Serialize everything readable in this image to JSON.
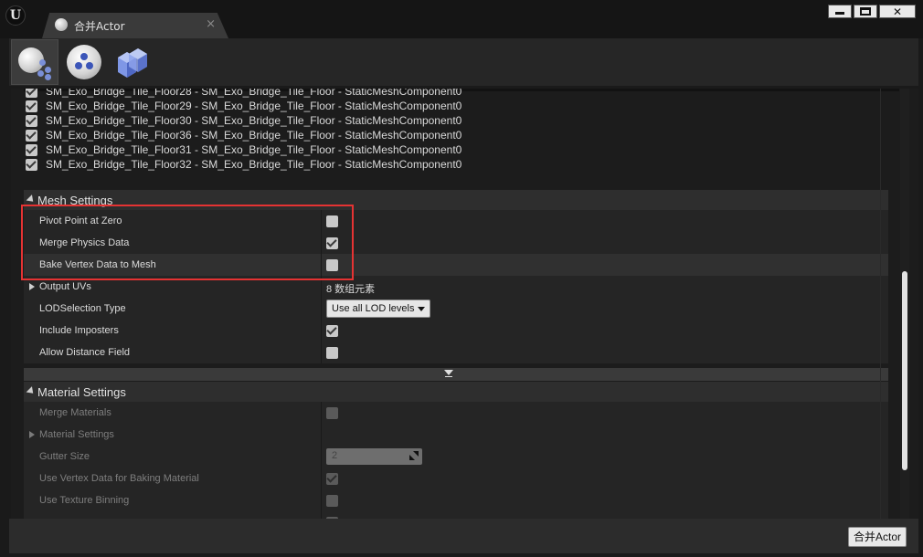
{
  "window": {
    "tab_title": "合并Actor",
    "tab_close": "×",
    "close_glyph": "✕"
  },
  "toolbar": {
    "tools": [
      {
        "icon": "actor-merge-icon",
        "active": true
      },
      {
        "icon": "harvest-instances-icon",
        "active": false
      },
      {
        "icon": "proxy-geometry-icon",
        "active": false
      }
    ]
  },
  "components": [
    "SM_Exo_Bridge_Tile_Floor28 - SM_Exo_Bridge_Tile_Floor - StaticMeshComponent0",
    "SM_Exo_Bridge_Tile_Floor29 - SM_Exo_Bridge_Tile_Floor - StaticMeshComponent0",
    "SM_Exo_Bridge_Tile_Floor30 - SM_Exo_Bridge_Tile_Floor - StaticMeshComponent0",
    "SM_Exo_Bridge_Tile_Floor36 - SM_Exo_Bridge_Tile_Floor - StaticMeshComponent0",
    "SM_Exo_Bridge_Tile_Floor31 - SM_Exo_Bridge_Tile_Floor - StaticMeshComponent0",
    "SM_Exo_Bridge_Tile_Floor32 - SM_Exo_Bridge_Tile_Floor - StaticMeshComponent0"
  ],
  "mesh_settings": {
    "title": "Mesh Settings",
    "pivot_point_at_zero": {
      "label": "Pivot Point at Zero",
      "checked": false
    },
    "merge_physics_data": {
      "label": "Merge Physics Data",
      "checked": true
    },
    "bake_vertex_data": {
      "label": "Bake Vertex Data to Mesh",
      "checked": false
    },
    "output_uvs": {
      "label": "Output UVs",
      "value": "8 数组元素"
    },
    "lod_selection_type": {
      "label": "LODSelection Type",
      "value": "Use all LOD levels"
    },
    "include_imposters": {
      "label": "Include Imposters",
      "checked": true
    },
    "allow_distance_field": {
      "label": "Allow Distance Field",
      "checked": false
    }
  },
  "material_settings": {
    "title": "Material Settings",
    "merge_materials": {
      "label": "Merge Materials",
      "checked": false
    },
    "material_settings_group": {
      "label": "Material Settings"
    },
    "gutter_size": {
      "label": "Gutter Size",
      "value": "2"
    },
    "use_vertex_data": {
      "label": "Use Vertex Data for Baking Material",
      "checked": true
    },
    "use_texture_binning": {
      "label": "Use Texture Binning",
      "checked": false
    }
  },
  "footer": {
    "merge_button": "合并Actor"
  },
  "colors": {
    "highlight": "#e53333",
    "panel_bg": "#1c1c1c",
    "row_bg": "#252525",
    "row_alt": "#303030"
  }
}
